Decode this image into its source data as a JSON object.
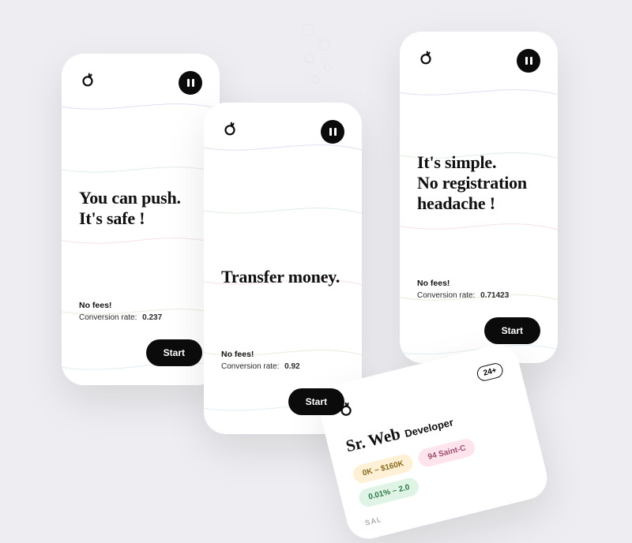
{
  "cards": [
    {
      "headline": "You can push.\nIt's safe !",
      "no_fees": "No fees!",
      "conv_label": "Conversion rate:",
      "conv_value": "0.237",
      "start": "Start"
    },
    {
      "headline": "Transfer money.",
      "no_fees": "No fees!",
      "conv_label": "Conversion rate:",
      "conv_value": "0.92",
      "start": "Start"
    },
    {
      "headline": "It's simple.\nNo registration headache !",
      "no_fees": "No fees!",
      "conv_label": "Conversion rate:",
      "conv_value": "0.71423",
      "start": "Start"
    }
  ],
  "job": {
    "title_main": "Sr. Web",
    "title_sub": "Developer",
    "badge": "24+",
    "salary": "0K – $160K",
    "location": "94 Saint-C",
    "equity": "0.01% – 2.0",
    "meta": "SAL"
  }
}
